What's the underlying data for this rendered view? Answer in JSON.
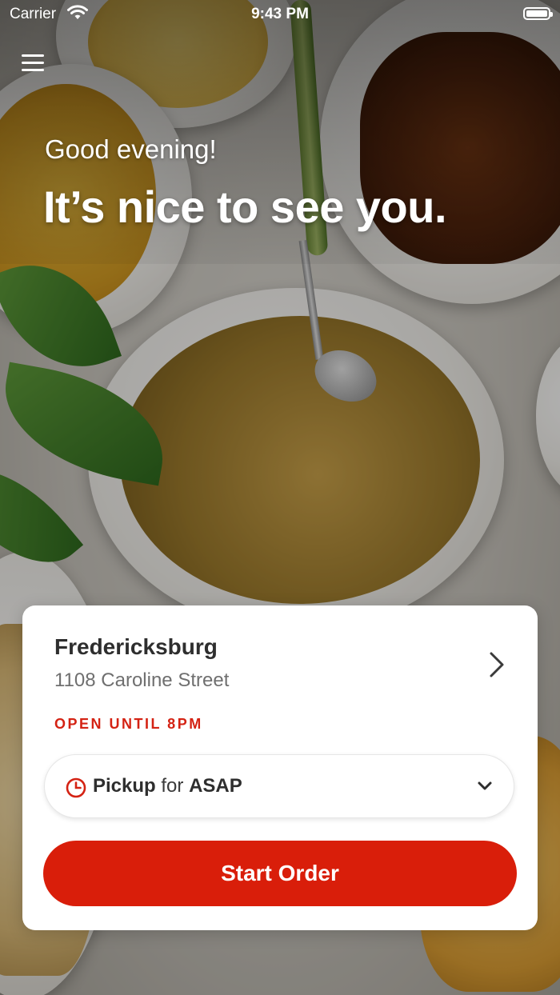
{
  "status_bar": {
    "carrier": "Carrier",
    "time": "9:43 PM"
  },
  "header": {
    "menu_icon": "hamburger-menu-icon"
  },
  "greeting": {
    "salutation": "Good evening!",
    "headline": "It’s nice to see you."
  },
  "location_card": {
    "name": "Fredericksburg",
    "address": "1108 Caroline Street",
    "hours_status": "OPEN UNTIL 8PM",
    "order_mode": "Pickup",
    "order_connector": "for",
    "order_time": "ASAP",
    "start_button_label": "Start Order"
  },
  "colors": {
    "brand_red": "#d91e0a",
    "status_red": "#d42213",
    "text_dark": "#2e2e2e",
    "text_muted": "#6f6f6f"
  }
}
